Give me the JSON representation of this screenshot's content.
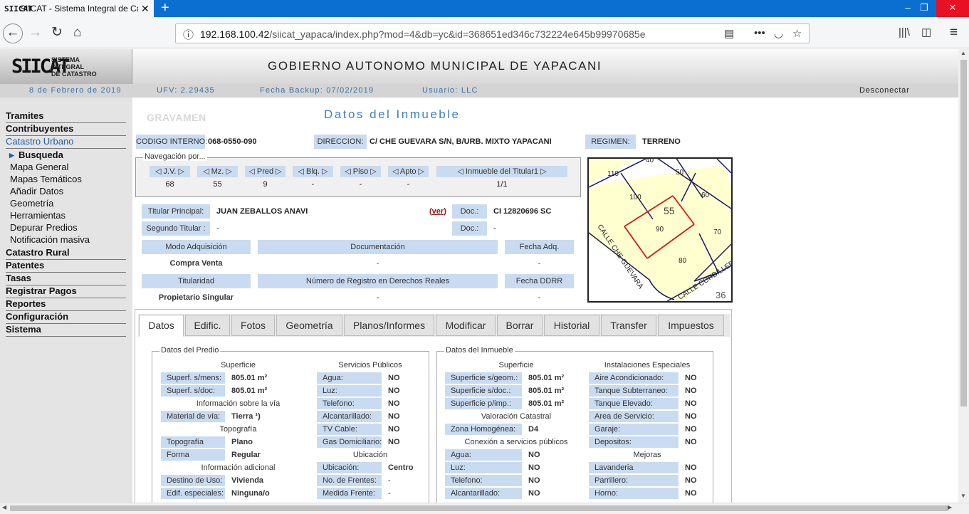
{
  "browser": {
    "tab_title": "SIICAT - Sistema Integral de Ca",
    "tab_favicon": "SIICAT",
    "url_host": "192.168.100.42",
    "url_path": "/siicat_yapaca/index.php?mod=4&db=yc&id=368651ed346c732224e645b99970685e"
  },
  "header": {
    "logo_mark": "SIICAT",
    "logo_line1": "SISTEMA",
    "logo_line2": "INTEGRAL",
    "logo_line3": "DE CATASTRO",
    "government": "GOBIERNO AUTONOMO MUNICIPAL DE YAPACANI"
  },
  "infobar": {
    "date": "8 de Febrero de 2019",
    "ufv": "UFV: 2.29435",
    "backup": "Fecha Backup: 07/02/2019",
    "user": "Usuario: LLC",
    "logout": "Desconectar"
  },
  "menu": {
    "tramites": "Tramites",
    "contribuyentes": "Contribuyentes",
    "catastro_urbano": "Catastro Urbano",
    "sub": [
      "Busqueda",
      "Mapa General",
      "Mapas Temáticos",
      "Añadir Datos",
      "Geometría",
      "Herramientas",
      "Depurar Predios",
      "Notificación masiva"
    ],
    "catastro_rural": "Catastro Rural",
    "patentes": "Patentes",
    "tasas": "Tasas",
    "registrar_pagos": "Registrar Pagos",
    "reportes": "Reportes",
    "configuracion": "Configuración",
    "sistema": "Sistema"
  },
  "content": {
    "gravamen": "GRAVAMEN",
    "title": "Datos del Inmueble",
    "codigo_label": "CODIGO INTERNO:",
    "codigo_value": "068-0550-090",
    "direccion_label": "DIRECCION:",
    "direccion_value": "C/ CHE GUEVARA S/N, B/URB. MIXTO YAPACANI",
    "regimen_label": "REGIMEN:",
    "regimen_value": "TERRENO"
  },
  "navegacion": {
    "legend": "Navegación por...",
    "items": [
      {
        "label": "◁ J.V. ▷",
        "value": "68"
      },
      {
        "label": "◁ Mz. ▷",
        "value": "55"
      },
      {
        "label": "◁ Pred ▷",
        "value": "9"
      },
      {
        "label": "◁ Blq. ▷",
        "value": "-"
      },
      {
        "label": "◁ Piso ▷",
        "value": "-"
      },
      {
        "label": "◁ Apto ▷",
        "value": "-"
      },
      {
        "label": "◁ Inmueble del Titular1 ▷",
        "value": "1/1"
      }
    ]
  },
  "titular": {
    "principal_label": "Titular Principal:",
    "principal_value": "JUAN ZEBALLOS ANAVI",
    "ver_open": "(",
    "ver_link": "ver",
    "ver_close": ")",
    "doc_label": "Doc.:",
    "doc_value": "CI 12820696 SC",
    "segundo_label": "Segundo Titular :",
    "segundo_value": "-",
    "doc2_label": "Doc.:",
    "doc2_value": "-",
    "modo_label": "Modo Adquisición",
    "documentacion_label": "Documentación",
    "fecha_adq_label": "Fecha Adq.",
    "modo_value": "Compra Venta",
    "documentacion_value": "-",
    "fecha_adq_value": "-",
    "titularidad_label": "Titularidad",
    "registro_label": "Número de Registro en Derechos Reales",
    "fecha_ddrr_label": "Fecha DDRR",
    "titularidad_value": "Propietario Singular",
    "registro_value": "-",
    "fecha_ddrr_value": "-"
  },
  "map": {
    "block": "55",
    "lots": [
      "110",
      "40",
      "50",
      "100",
      "60",
      "90",
      "70",
      "80"
    ],
    "street1": "CALLE CHE GUEVARA",
    "street2": "CALLE CORDILLERA",
    "corner_block": "36"
  },
  "tabs": [
    "Datos",
    "Edific.",
    "Fotos",
    "Geometría",
    "Planos/Informes",
    "Modificar",
    "Borrar",
    "Historial",
    "Transfer",
    "Impuestos"
  ],
  "predio": {
    "legend": "Datos del Predio",
    "h_superficie": "Superficie",
    "h_servicios": "Servicios Públicos",
    "sup_mens_label": "Superf. s/mens:",
    "sup_mens_value": "805.01 m²",
    "sup_doc_label": "Superf. s/doc:",
    "sup_doc_value": "805.01 m²",
    "h_via": "Información sobre la vía",
    "material_label": "Material de vía:",
    "material_value": "Tierra ¹)",
    "h_topografia": "Topografía",
    "topografia_label": "Topografía",
    "topografia_value": "Plano",
    "forma_label": "Forma",
    "forma_value": "Regular",
    "h_adicional": "Información adicional",
    "destino_label": "Destino de Uso:",
    "destino_value": "Vivienda",
    "edif_label": "Edif. especiales:",
    "edif_value": "Ninguna/o",
    "agua_label": "Agua:",
    "agua_value": "NO",
    "luz_label": "Luz:",
    "luz_value": "NO",
    "telefono_label": "Telefono:",
    "telefono_value": "NO",
    "alcantarillado_label": "Alcantarillado:",
    "alcantarillado_value": "NO",
    "tvcable_label": "TV Cable:",
    "tvcable_value": "NO",
    "gas_label": "Gas Domiciliario:",
    "gas_value": "NO",
    "h_ubicacion": "Ubicación",
    "ubicacion_label": "Ubicación:",
    "ubicacion_value": "Centro",
    "frentes_label": "No. de Frentes:",
    "frentes_value": "-",
    "medida_label": "Medida Frente:",
    "medida_value": "-"
  },
  "inmueble": {
    "legend": "Datos del Inmueble",
    "h_superficie": "Superficie",
    "h_instalaciones": "Instalaciones Especiales",
    "sup_geom_label": "Superficie s/geom.:",
    "sup_geom_value": "805.01 m²",
    "sup_doc_label": "Superficie s/doc.:",
    "sup_doc_value": "805.01 m²",
    "sup_imp_label": "Superficie p/imp.:",
    "sup_imp_value": "805.01 m²",
    "h_valoracion": "Valoración Catastral",
    "zona_label": "Zona Homogénea:",
    "zona_value": "D4",
    "h_conexion": "Conexión a servicios públicos",
    "agua_label": "Agua:",
    "agua_value": "NO",
    "luz_label": "Luz:",
    "luz_value": "NO",
    "telefono_label": "Telefono:",
    "telefono_value": "NO",
    "alcantarillado_label": "Alcantarillado:",
    "alcantarillado_value": "NO",
    "aire_label": "Aire Acondicionado:",
    "aire_value": "NO",
    "tanque_sub_label": "Tanque Subterraneo:",
    "tanque_sub_value": "NO",
    "tanque_elev_label": "Tanque Elevado:",
    "tanque_elev_value": "NO",
    "area_serv_label": "Area de Servicio:",
    "area_serv_value": "NO",
    "garaje_label": "Garaje:",
    "garaje_value": "NO",
    "depositos_label": "Depositos:",
    "depositos_value": "NO",
    "h_mejoras": "Mejoras",
    "lavanderia_label": "Lavanderia",
    "lavanderia_value": "NO",
    "parrillero_label": "Parrillero:",
    "parrillero_value": "NO",
    "horno_label": "Horno:",
    "horno_value": "NO"
  },
  "colors": {
    "browser_tabbar": "#0b6fd1",
    "label_bg": "#c9dbf0",
    "title_blue": "#3e80c3",
    "link_red": "#8b1a1a",
    "parcel_red": "#d11a1a",
    "map_fill": "#ffffd0"
  }
}
